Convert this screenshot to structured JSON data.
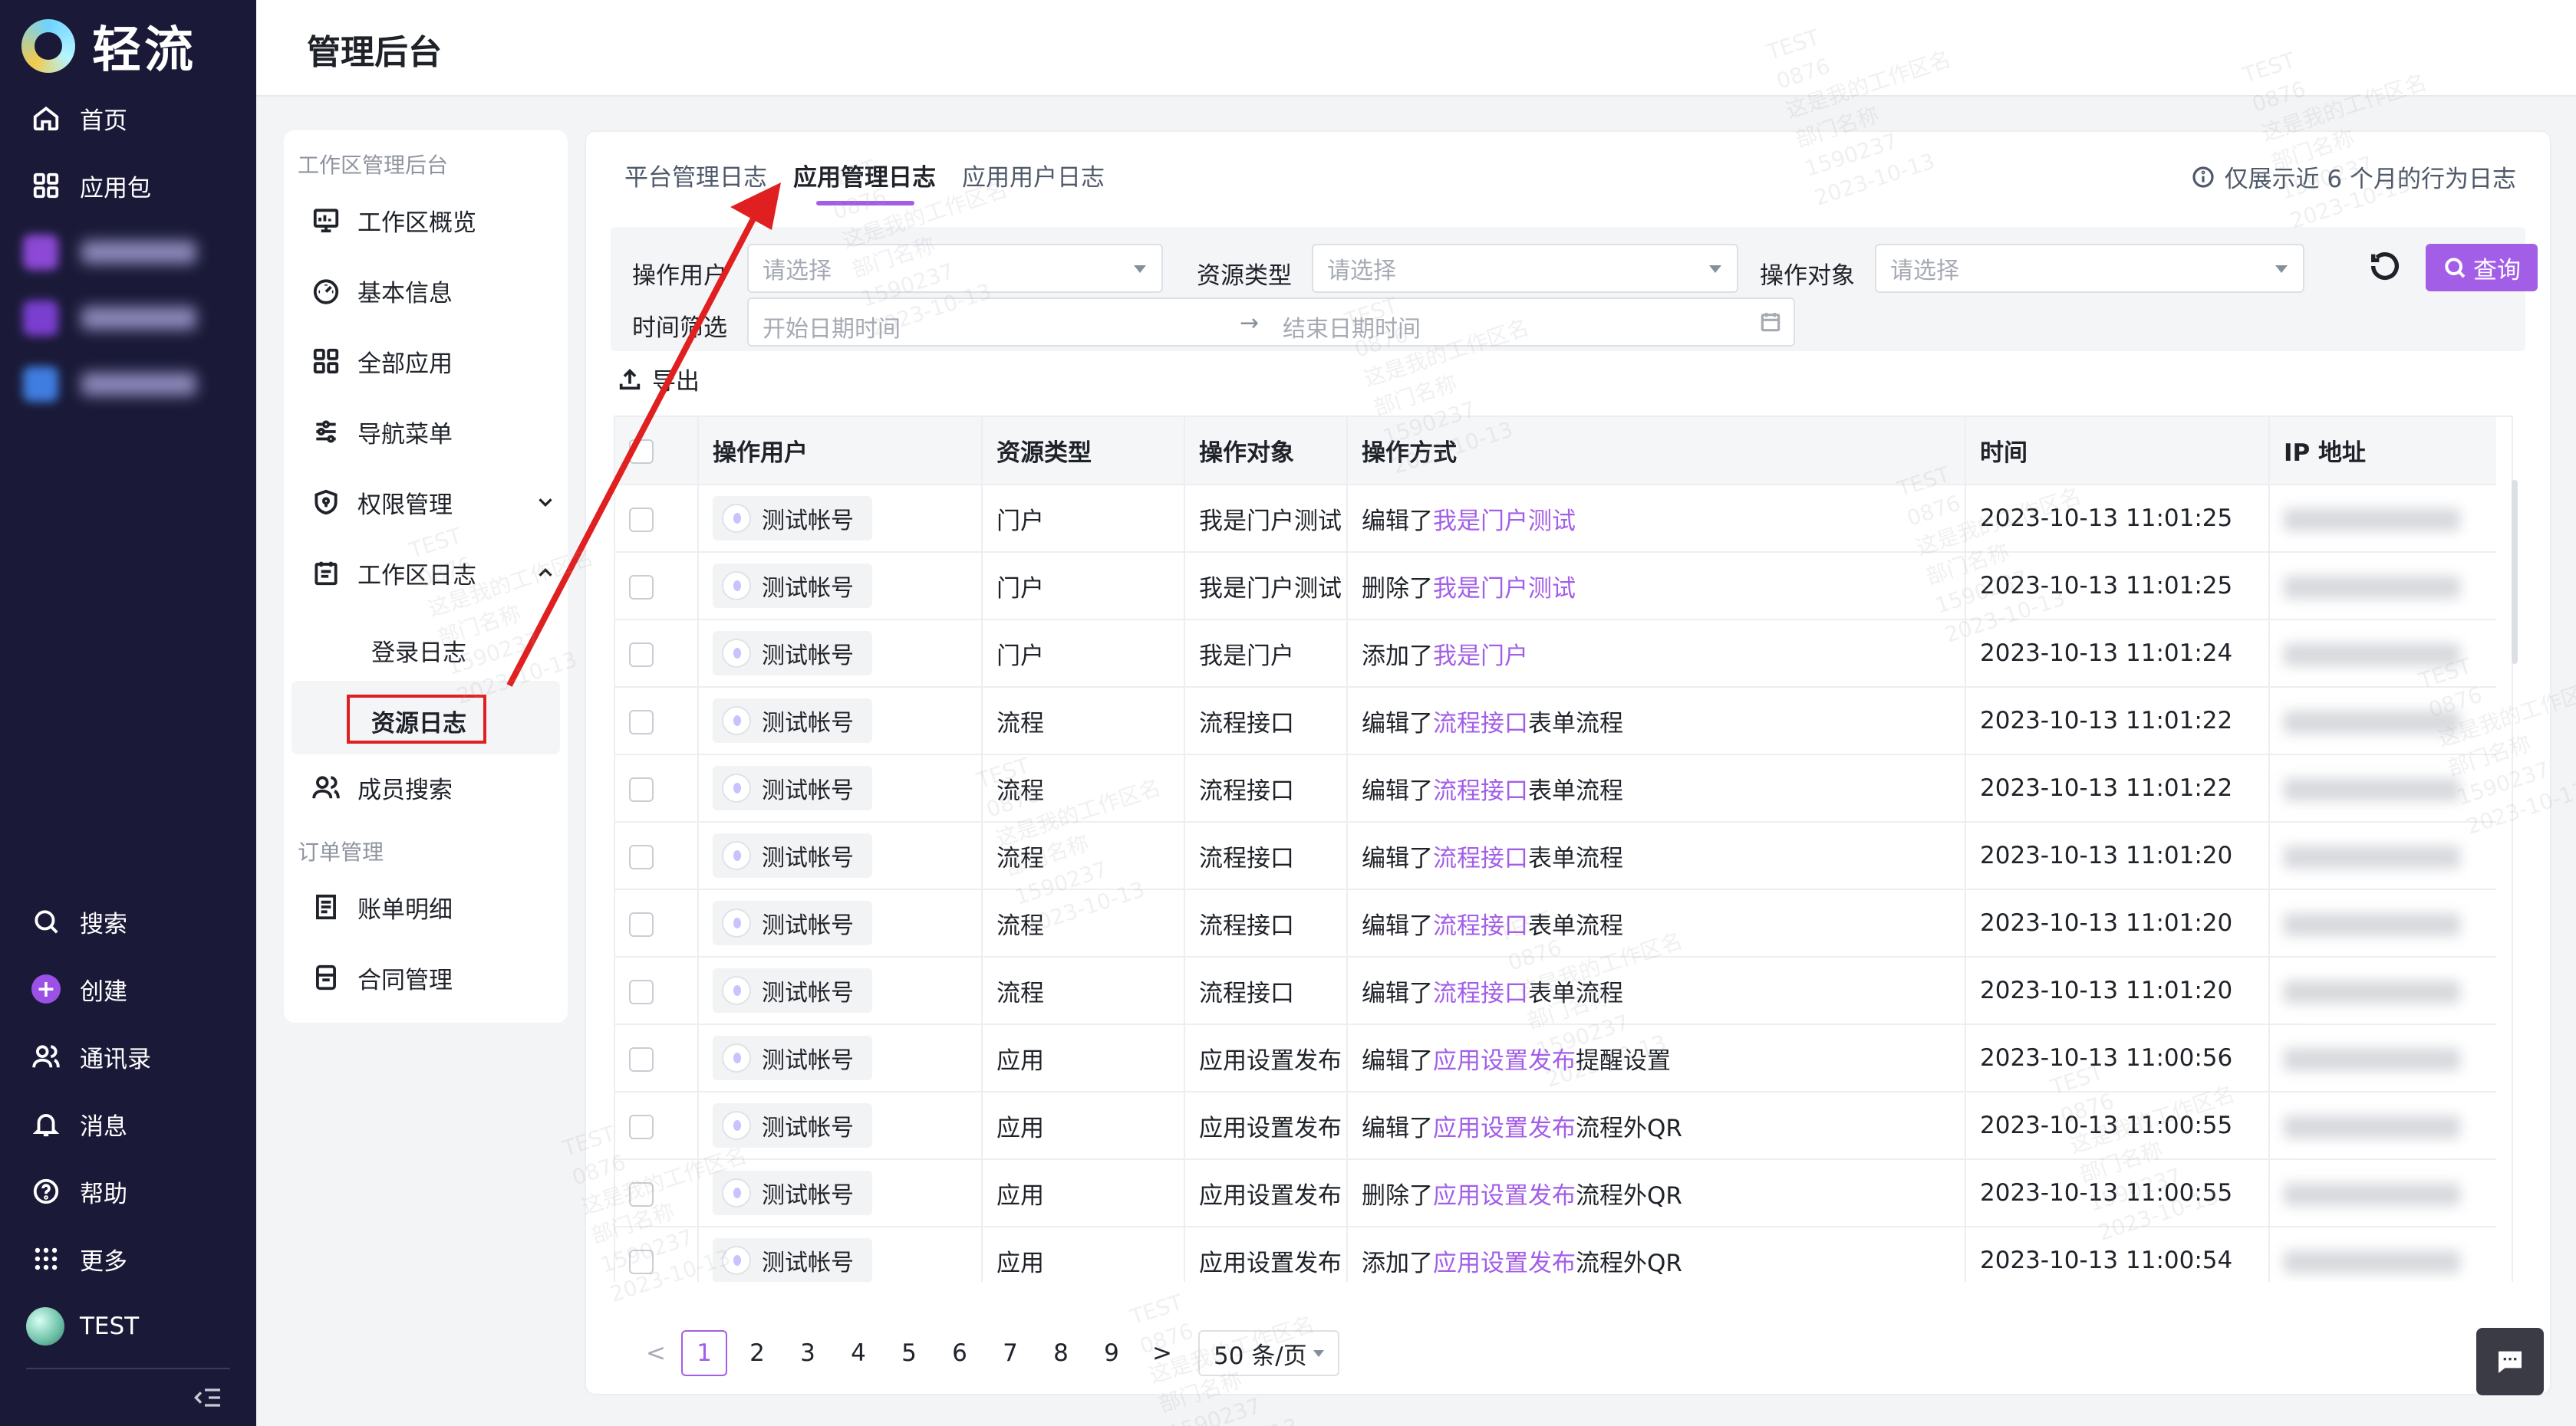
{
  "brand": {
    "name": "轻流"
  },
  "leftnav": {
    "top_items": [
      {
        "label": "首页",
        "icon": "home-icon"
      },
      {
        "label": "应用包",
        "icon": "grid-icon"
      }
    ],
    "bottom_items": [
      {
        "label": "搜索",
        "icon": "search-icon"
      },
      {
        "label": "创建",
        "icon": "plus-icon"
      },
      {
        "label": "通讯录",
        "icon": "contacts-icon"
      },
      {
        "label": "消息",
        "icon": "bell-icon"
      },
      {
        "label": "帮助",
        "icon": "help-icon"
      },
      {
        "label": "更多",
        "icon": "apps-icon"
      },
      {
        "label": "TEST",
        "icon": "avatar"
      }
    ]
  },
  "header": {
    "title": "管理后台"
  },
  "sidebar": {
    "group1": "工作区管理后台",
    "items": [
      {
        "label": "工作区概览",
        "icon": "dashboard-icon"
      },
      {
        "label": "基本信息",
        "icon": "gauge-icon"
      },
      {
        "label": "全部应用",
        "icon": "grid-icon"
      },
      {
        "label": "导航菜单",
        "icon": "sliders-icon"
      },
      {
        "label": "权限管理",
        "icon": "shield-icon"
      },
      {
        "label": "工作区日志",
        "icon": "calendar-icon"
      }
    ],
    "sub_items": [
      {
        "label": "登录日志"
      },
      {
        "label": "资源日志"
      }
    ],
    "member_search": "成员搜索",
    "group2": "订单管理",
    "order_items": [
      {
        "label": "账单明细",
        "icon": "receipt-icon"
      },
      {
        "label": "合同管理",
        "icon": "contract-icon"
      }
    ]
  },
  "tabs": [
    {
      "label": "平台管理日志"
    },
    {
      "label": "应用管理日志"
    },
    {
      "label": "应用用户日志"
    }
  ],
  "notice": "仅展示近 6 个月的行为日志",
  "filters": {
    "operator_label": "操作用户",
    "operator_placeholder": "请选择",
    "resource_type_label": "资源类型",
    "resource_type_placeholder": "请选择",
    "target_label": "操作对象",
    "target_placeholder": "请选择",
    "time_label": "时间筛选",
    "start_placeholder": "开始日期时间",
    "end_placeholder": "结束日期时间",
    "range_arrow": "→",
    "query_label": "查询"
  },
  "export_label": "导出",
  "table": {
    "headers": [
      "操作用户",
      "资源类型",
      "操作对象",
      "操作方式",
      "时间",
      "IP 地址"
    ],
    "rows": [
      {
        "user": "测试帐号",
        "type": "门户",
        "target": "我是门户测试",
        "action_pre": "编辑了",
        "action_link": "我是门户测试",
        "action_post": "",
        "time": "2023-10-13 11:01:25"
      },
      {
        "user": "测试帐号",
        "type": "门户",
        "target": "我是门户测试",
        "action_pre": "删除了",
        "action_link": "我是门户测试",
        "action_post": "",
        "time": "2023-10-13 11:01:25"
      },
      {
        "user": "测试帐号",
        "type": "门户",
        "target": "我是门户",
        "action_pre": "添加了",
        "action_link": "我是门户",
        "action_post": "",
        "time": "2023-10-13 11:01:24"
      },
      {
        "user": "测试帐号",
        "type": "流程",
        "target": "流程接口",
        "action_pre": "编辑了",
        "action_link": "流程接口",
        "action_post": "表单流程",
        "time": "2023-10-13 11:01:22"
      },
      {
        "user": "测试帐号",
        "type": "流程",
        "target": "流程接口",
        "action_pre": "编辑了",
        "action_link": "流程接口",
        "action_post": "表单流程",
        "time": "2023-10-13 11:01:22"
      },
      {
        "user": "测试帐号",
        "type": "流程",
        "target": "流程接口",
        "action_pre": "编辑了",
        "action_link": "流程接口",
        "action_post": "表单流程",
        "time": "2023-10-13 11:01:20"
      },
      {
        "user": "测试帐号",
        "type": "流程",
        "target": "流程接口",
        "action_pre": "编辑了",
        "action_link": "流程接口",
        "action_post": "表单流程",
        "time": "2023-10-13 11:01:20"
      },
      {
        "user": "测试帐号",
        "type": "流程",
        "target": "流程接口",
        "action_pre": "编辑了",
        "action_link": "流程接口",
        "action_post": "表单流程",
        "time": "2023-10-13 11:01:20"
      },
      {
        "user": "测试帐号",
        "type": "应用",
        "target": "应用设置发布",
        "action_pre": "编辑了",
        "action_link": "应用设置发布",
        "action_post": "提醒设置",
        "time": "2023-10-13 11:00:56"
      },
      {
        "user": "测试帐号",
        "type": "应用",
        "target": "应用设置发布",
        "action_pre": "编辑了",
        "action_link": "应用设置发布",
        "action_post": "流程外QR",
        "time": "2023-10-13 11:00:55"
      },
      {
        "user": "测试帐号",
        "type": "应用",
        "target": "应用设置发布",
        "action_pre": "删除了",
        "action_link": "应用设置发布",
        "action_post": "流程外QR",
        "time": "2023-10-13 11:00:55"
      },
      {
        "user": "测试帐号",
        "type": "应用",
        "target": "应用设置发布",
        "action_pre": "添加了",
        "action_link": "应用设置发布",
        "action_post": "流程外QR",
        "time": "2023-10-13 11:00:54"
      }
    ]
  },
  "pagination": {
    "prev": "<",
    "pages": [
      "1",
      "2",
      "3",
      "4",
      "5",
      "6",
      "7",
      "8",
      "9"
    ],
    "next": ">",
    "page_size": "50 条/页"
  },
  "watermark": "TEST\n0876\n这是我的工作区名\n部门名称\n1590237\n2023-10-13",
  "colors": {
    "accent": "#a35ee8",
    "nav_bg": "#1a1a38",
    "annotation": "#e02020"
  }
}
